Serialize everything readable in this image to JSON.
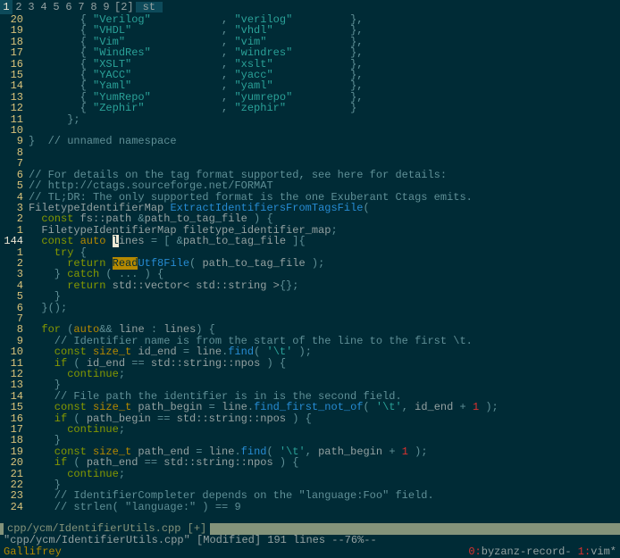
{
  "workspace": {
    "active_index": 0,
    "items": [
      "1",
      "2",
      "3",
      "4",
      "5",
      "6",
      "7",
      "8",
      "9",
      "[2]"
    ],
    "app": "st"
  },
  "gutter": [
    "20",
    "19",
    "18",
    "17",
    "16",
    "15",
    "14",
    "13",
    "12",
    "11",
    "10",
    "9",
    "8",
    "7",
    "6",
    "5",
    "4",
    "3",
    "2",
    "1",
    "144",
    "1",
    "2",
    "3",
    "4",
    "5",
    "6",
    "7",
    "8",
    "9",
    "10",
    "11",
    "12",
    "13",
    "14",
    "15",
    "16",
    "17",
    "18",
    "19",
    "20",
    "21",
    "22",
    "23",
    "24"
  ],
  "cursor_row": 20,
  "code": [
    [
      {
        "c": "c-punc",
        "t": "        { "
      },
      {
        "c": "c-str",
        "t": "\"Verilog\""
      },
      {
        "c": "c-punc",
        "t": "           , "
      },
      {
        "c": "c-str",
        "t": "\"verilog\""
      },
      {
        "c": "c-punc",
        "t": "         },"
      }
    ],
    [
      {
        "c": "c-punc",
        "t": "        { "
      },
      {
        "c": "c-str",
        "t": "\"VHDL\""
      },
      {
        "c": "c-punc",
        "t": "              , "
      },
      {
        "c": "c-str",
        "t": "\"vhdl\""
      },
      {
        "c": "c-punc",
        "t": "            },"
      }
    ],
    [
      {
        "c": "c-punc",
        "t": "        { "
      },
      {
        "c": "c-str",
        "t": "\"Vim\""
      },
      {
        "c": "c-punc",
        "t": "               , "
      },
      {
        "c": "c-str",
        "t": "\"vim\""
      },
      {
        "c": "c-punc",
        "t": "             },"
      }
    ],
    [
      {
        "c": "c-punc",
        "t": "        { "
      },
      {
        "c": "c-str",
        "t": "\"WindRes\""
      },
      {
        "c": "c-punc",
        "t": "           , "
      },
      {
        "c": "c-str",
        "t": "\"windres\""
      },
      {
        "c": "c-punc",
        "t": "         },"
      }
    ],
    [
      {
        "c": "c-punc",
        "t": "        { "
      },
      {
        "c": "c-str",
        "t": "\"XSLT\""
      },
      {
        "c": "c-punc",
        "t": "              , "
      },
      {
        "c": "c-str",
        "t": "\"xslt\""
      },
      {
        "c": "c-punc",
        "t": "            },"
      }
    ],
    [
      {
        "c": "c-punc",
        "t": "        { "
      },
      {
        "c": "c-str",
        "t": "\"YACC\""
      },
      {
        "c": "c-punc",
        "t": "              , "
      },
      {
        "c": "c-str",
        "t": "\"yacc\""
      },
      {
        "c": "c-punc",
        "t": "            },"
      }
    ],
    [
      {
        "c": "c-punc",
        "t": "        { "
      },
      {
        "c": "c-str",
        "t": "\"Yaml\""
      },
      {
        "c": "c-punc",
        "t": "              , "
      },
      {
        "c": "c-str",
        "t": "\"yaml\""
      },
      {
        "c": "c-punc",
        "t": "            },"
      }
    ],
    [
      {
        "c": "c-punc",
        "t": "        { "
      },
      {
        "c": "c-str",
        "t": "\"YumRepo\""
      },
      {
        "c": "c-punc",
        "t": "           , "
      },
      {
        "c": "c-str",
        "t": "\"yumrepo\""
      },
      {
        "c": "c-punc",
        "t": "         },"
      }
    ],
    [
      {
        "c": "c-punc",
        "t": "        { "
      },
      {
        "c": "c-str",
        "t": "\"Zephir\""
      },
      {
        "c": "c-punc",
        "t": "            , "
      },
      {
        "c": "c-str",
        "t": "\"zephir\""
      },
      {
        "c": "c-punc",
        "t": "          }"
      }
    ],
    [
      {
        "c": "c-punc",
        "t": "      };"
      }
    ],
    [
      {
        "c": "",
        "t": ""
      }
    ],
    [
      {
        "c": "c-punc",
        "t": "}  "
      },
      {
        "c": "c-comm",
        "t": "// unnamed namespace"
      }
    ],
    [
      {
        "c": "",
        "t": ""
      }
    ],
    [
      {
        "c": "",
        "t": ""
      }
    ],
    [
      {
        "c": "c-comm",
        "t": "// For details on the tag format supported, see here for details:"
      }
    ],
    [
      {
        "c": "c-comm",
        "t": "// http://ctags.sourceforge.net/FORMAT"
      }
    ],
    [
      {
        "c": "c-comm",
        "t": "// TL;DR: The only supported format is the one Exuberant Ctags emits."
      }
    ],
    [
      {
        "c": "c-def",
        "t": "FiletypeIdentifierMap "
      },
      {
        "c": "c-func",
        "t": "ExtractIdentifiersFromTagsFile"
      },
      {
        "c": "c-punc",
        "t": "("
      }
    ],
    [
      {
        "c": "c-kw",
        "t": "  const "
      },
      {
        "c": "c-def",
        "t": "fs::path "
      },
      {
        "c": "c-punc",
        "t": "&"
      },
      {
        "c": "c-id",
        "t": "path_to_tag_file"
      },
      {
        "c": "c-punc",
        "t": " ) {"
      }
    ],
    [
      {
        "c": "c-def",
        "t": "  FiletypeIdentifierMap "
      },
      {
        "c": "c-id",
        "t": "filetype_identifier_map"
      },
      {
        "c": "c-punc",
        "t": ";"
      }
    ],
    [
      {
        "c": "c-kw",
        "t": "  const "
      },
      {
        "c": "c-type",
        "t": "auto "
      },
      {
        "c": "cursor",
        "t": "l"
      },
      {
        "c": "c-id",
        "t": "ines"
      },
      {
        "c": "c-punc",
        "t": " = [ &"
      },
      {
        "c": "c-id",
        "t": "path_to_tag_file"
      },
      {
        "c": "c-punc",
        "t": " ]{"
      }
    ],
    [
      {
        "c": "c-kw",
        "t": "    try"
      },
      {
        "c": "c-punc",
        "t": " {"
      }
    ],
    [
      {
        "c": "c-kw",
        "t": "      return "
      },
      {
        "c": "hl",
        "t": "Read"
      },
      {
        "c": "c-func",
        "t": "Utf8File"
      },
      {
        "c": "c-punc",
        "t": "( "
      },
      {
        "c": "c-id",
        "t": "path_to_tag_file"
      },
      {
        "c": "c-punc",
        "t": " );"
      }
    ],
    [
      {
        "c": "c-punc",
        "t": "    } "
      },
      {
        "c": "c-kw",
        "t": "catch"
      },
      {
        "c": "c-punc",
        "t": " ( ... ) {"
      }
    ],
    [
      {
        "c": "c-kw",
        "t": "      return "
      },
      {
        "c": "c-def",
        "t": "std::vector< std::string >"
      },
      {
        "c": "c-punc",
        "t": "{};"
      }
    ],
    [
      {
        "c": "c-punc",
        "t": "    }"
      }
    ],
    [
      {
        "c": "c-punc",
        "t": "  }();"
      }
    ],
    [
      {
        "c": "",
        "t": ""
      }
    ],
    [
      {
        "c": "c-kw",
        "t": "  for"
      },
      {
        "c": "c-punc",
        "t": " ("
      },
      {
        "c": "c-type",
        "t": "auto"
      },
      {
        "c": "c-punc",
        "t": "&& "
      },
      {
        "c": "c-id",
        "t": "line"
      },
      {
        "c": "c-punc",
        "t": " : "
      },
      {
        "c": "c-id",
        "t": "lines"
      },
      {
        "c": "c-punc",
        "t": ") {"
      }
    ],
    [
      {
        "c": "c-comm",
        "t": "    // Identifier name is from the start of the line to the first \\t."
      }
    ],
    [
      {
        "c": "c-kw",
        "t": "    const "
      },
      {
        "c": "c-type",
        "t": "size_t"
      },
      {
        "c": "c-id",
        "t": " id_end"
      },
      {
        "c": "c-punc",
        "t": " = "
      },
      {
        "c": "c-id",
        "t": "line"
      },
      {
        "c": "c-punc",
        "t": "."
      },
      {
        "c": "c-func",
        "t": "find"
      },
      {
        "c": "c-punc",
        "t": "( "
      },
      {
        "c": "c-charlit",
        "t": "'\\t'"
      },
      {
        "c": "c-punc",
        "t": " );"
      }
    ],
    [
      {
        "c": "c-kw",
        "t": "    if"
      },
      {
        "c": "c-punc",
        "t": " ( "
      },
      {
        "c": "c-id",
        "t": "id_end"
      },
      {
        "c": "c-punc",
        "t": " == "
      },
      {
        "c": "c-id",
        "t": "std::string::npos"
      },
      {
        "c": "c-punc",
        "t": " ) {"
      }
    ],
    [
      {
        "c": "c-kw",
        "t": "      continue"
      },
      {
        "c": "c-punc",
        "t": ";"
      }
    ],
    [
      {
        "c": "c-punc",
        "t": "    }"
      }
    ],
    [
      {
        "c": "c-comm",
        "t": "    // File path the identifier is in is the second field."
      }
    ],
    [
      {
        "c": "c-kw",
        "t": "    const "
      },
      {
        "c": "c-type",
        "t": "size_t"
      },
      {
        "c": "c-id",
        "t": " path_begin"
      },
      {
        "c": "c-punc",
        "t": " = "
      },
      {
        "c": "c-id",
        "t": "line"
      },
      {
        "c": "c-punc",
        "t": "."
      },
      {
        "c": "c-func",
        "t": "find_first_not_of"
      },
      {
        "c": "c-punc",
        "t": "( "
      },
      {
        "c": "c-charlit",
        "t": "'\\t'"
      },
      {
        "c": "c-punc",
        "t": ", "
      },
      {
        "c": "c-id",
        "t": "id_end"
      },
      {
        "c": "c-punc",
        "t": " + "
      },
      {
        "c": "c-num",
        "t": "1"
      },
      {
        "c": "c-punc",
        "t": " );"
      }
    ],
    [
      {
        "c": "c-kw",
        "t": "    if"
      },
      {
        "c": "c-punc",
        "t": " ( "
      },
      {
        "c": "c-id",
        "t": "path_begin"
      },
      {
        "c": "c-punc",
        "t": " == "
      },
      {
        "c": "c-id",
        "t": "std::string::npos"
      },
      {
        "c": "c-punc",
        "t": " ) {"
      }
    ],
    [
      {
        "c": "c-kw",
        "t": "      continue"
      },
      {
        "c": "c-punc",
        "t": ";"
      }
    ],
    [
      {
        "c": "c-punc",
        "t": "    }"
      }
    ],
    [
      {
        "c": "c-kw",
        "t": "    const "
      },
      {
        "c": "c-type",
        "t": "size_t"
      },
      {
        "c": "c-id",
        "t": " path_end"
      },
      {
        "c": "c-punc",
        "t": " = "
      },
      {
        "c": "c-id",
        "t": "line"
      },
      {
        "c": "c-punc",
        "t": "."
      },
      {
        "c": "c-func",
        "t": "find"
      },
      {
        "c": "c-punc",
        "t": "( "
      },
      {
        "c": "c-charlit",
        "t": "'\\t'"
      },
      {
        "c": "c-punc",
        "t": ", "
      },
      {
        "c": "c-id",
        "t": "path_begin"
      },
      {
        "c": "c-punc",
        "t": " + "
      },
      {
        "c": "c-num",
        "t": "1"
      },
      {
        "c": "c-punc",
        "t": " );"
      }
    ],
    [
      {
        "c": "c-kw",
        "t": "    if"
      },
      {
        "c": "c-punc",
        "t": " ( "
      },
      {
        "c": "c-id",
        "t": "path_end"
      },
      {
        "c": "c-punc",
        "t": " == "
      },
      {
        "c": "c-id",
        "t": "std::string::npos"
      },
      {
        "c": "c-punc",
        "t": " ) {"
      }
    ],
    [
      {
        "c": "c-kw",
        "t": "      continue"
      },
      {
        "c": "c-punc",
        "t": ";"
      }
    ],
    [
      {
        "c": "c-punc",
        "t": "    }"
      }
    ],
    [
      {
        "c": "c-comm",
        "t": "    // IdentifierCompleter depends on the \"language:Foo\" field."
      }
    ],
    [
      {
        "c": "c-comm",
        "t": "    // strlen( \"language:\" ) == 9"
      }
    ]
  ],
  "tabline": {
    "file": "cpp/ycm/IdentifierUtils.cpp [+]"
  },
  "status1": "\"cpp/ycm/IdentifierUtils.cpp\" [Modified] 191 lines --76%--",
  "status2": {
    "host": "Gallifrey",
    "right_prefix": "0:",
    "right_a": "byzanz-record-",
    "right_mid": " 1:",
    "right_b": "vim*"
  }
}
